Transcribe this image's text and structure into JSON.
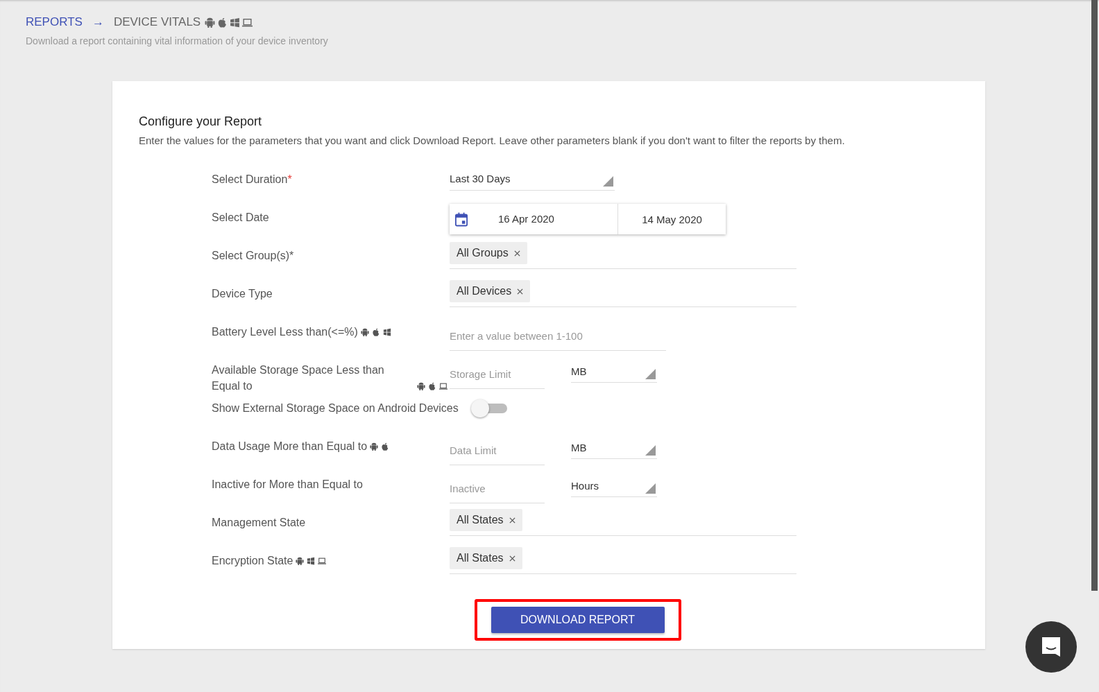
{
  "breadcrumb": {
    "parent": "REPORTS",
    "separator": "→",
    "current": "DEVICE VITALS",
    "platforms": [
      {
        "kind": "android"
      },
      {
        "kind": "apple"
      },
      {
        "kind": "windows"
      },
      {
        "kind": "laptop"
      }
    ]
  },
  "subtitle": "Download a report containing vital information of your device inventory",
  "card": {
    "title": "Configure your Report",
    "description": "Enter the values for the parameters that you want and click Download Report. Leave other parameters blank if you don't want to filter the reports by them.",
    "rows": [
      {
        "kind": "select",
        "label": "Select Duration",
        "required_mark": "*",
        "platforms": [],
        "value": "Last 30 Days"
      },
      {
        "kind": "daterange",
        "label": "Select Date",
        "platforms": [],
        "start": "16 Apr 2020",
        "end": "14 May 2020"
      },
      {
        "kind": "chips",
        "label": "Select Group(s)*",
        "platforms": [],
        "chips": [
          "All Groups"
        ]
      },
      {
        "kind": "chips",
        "label": "Device Type",
        "platforms": [],
        "chips": [
          "All Devices"
        ]
      },
      {
        "kind": "input",
        "label": "Battery Level Less than(<=%)",
        "platforms": [
          {
            "kind": "android"
          },
          {
            "kind": "apple"
          },
          {
            "kind": "windows"
          }
        ],
        "placeholder": "Enter a value between 1-100"
      },
      {
        "kind": "input-unit",
        "label": "Available Storage Space Less than Equal to",
        "platforms": [
          {
            "kind": "android"
          },
          {
            "kind": "apple"
          },
          {
            "kind": "laptop"
          }
        ],
        "placeholder": "Storage Limit",
        "unit": "MB"
      },
      {
        "kind": "toggle",
        "label": "Show External Storage Space on Android Devices",
        "platforms": [],
        "on": false
      },
      {
        "kind": "input-unit",
        "label": "Data Usage More than Equal to",
        "platforms": [
          {
            "kind": "android"
          },
          {
            "kind": "apple"
          }
        ],
        "placeholder": "Data Limit",
        "unit": "MB"
      },
      {
        "kind": "input-unit",
        "label": "Inactive for More than Equal to",
        "platforms": [],
        "placeholder": "Inactive",
        "unit": "Hours"
      },
      {
        "kind": "chips",
        "label": "Management State",
        "platforms": [],
        "chips": [
          "All States"
        ]
      },
      {
        "kind": "chips",
        "label": "Encryption State",
        "platforms": [
          {
            "kind": "android"
          },
          {
            "kind": "windows"
          },
          {
            "kind": "laptop"
          }
        ],
        "chips": [
          "All States"
        ]
      }
    ],
    "button": {
      "label": "DOWNLOAD REPORT",
      "highlighted": true
    }
  }
}
